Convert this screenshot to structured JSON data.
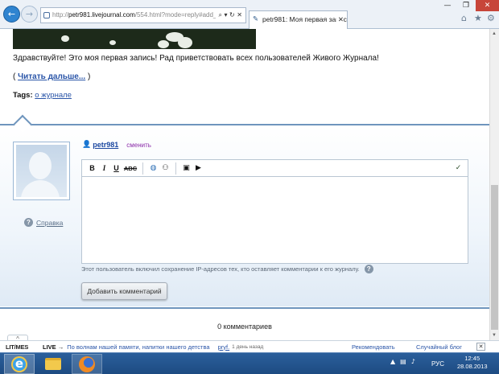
{
  "browser": {
    "address_prefix": "http://",
    "address_host": "petr981.livejournal.com",
    "address_rest": "/554.html?mode=reply#add_commen",
    "address_icons": "⌕ ▾ ↻ ✕",
    "tab_title": "petr981: Моя первая запис...",
    "tab_close": "✕",
    "window_min": "—",
    "window_max": "❐",
    "window_close": "✕",
    "home_icon": "⌂",
    "favorites_icon": "★",
    "settings_icon": "⚙"
  },
  "post": {
    "greeting": "Здравствуйте! Это моя первая запись! Рад приветствовать всех пользователей Живого Журнала!",
    "read_open": "( ",
    "read_more": "Читать дальше...",
    "read_close": " )",
    "tags_label": "Tags:",
    "tag": "о журнале"
  },
  "comment_form": {
    "username": "petr981",
    "switch_label": "сменить",
    "help_label": "Справка",
    "toolbar": {
      "bold": "B",
      "italic": "I",
      "underline": "U",
      "strike": "ABC"
    },
    "ip_note": "Этот пользователь включил сохранение IP-адресов тех, кто оставляет комментарии к его журналу.",
    "submit_label": "Добавить комментарий",
    "comments_count": "0 комментариев",
    "up_arrow": "^"
  },
  "adbar": {
    "logo": "LIT/MES",
    "live": "LIVE →",
    "link": "По волнам нашей памяти, напитки нашего детства",
    "user": "pryf.",
    "ago": "1 день назад",
    "recommend": "Рекомендовать",
    "random": "Случайный блог",
    "close": "✕"
  },
  "taskbar": {
    "lang": "РУС",
    "time": "12:45",
    "date": "28.08.2013"
  },
  "colors": {
    "link": "#2a55a8",
    "border_accent": "#6f95bd",
    "taskbar": "#2b5f9c",
    "close_red": "#c7453a"
  }
}
